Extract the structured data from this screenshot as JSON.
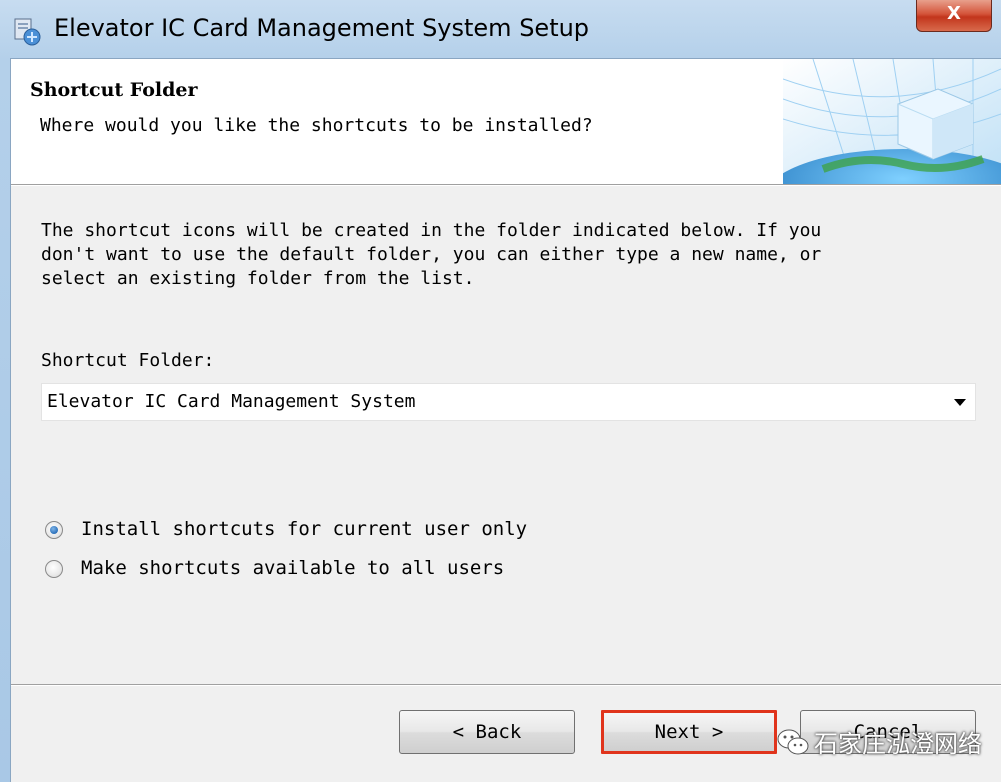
{
  "window": {
    "title": "Elevator IC Card Management System Setup",
    "close_label": "X"
  },
  "header": {
    "title": "Shortcut Folder",
    "subtitle": "Where would you like the shortcuts to be installed?"
  },
  "body": {
    "description": "The shortcut icons will be created in the folder indicated below. If you\ndon't want to use the default folder, you can either type a new name, or\nselect an existing folder from the list.",
    "folder_label": "Shortcut Folder:",
    "folder_value": "Elevator IC Card Management System"
  },
  "options": [
    {
      "label": "Install shortcuts for current user only",
      "selected": true
    },
    {
      "label": "Make shortcuts available to all users",
      "selected": false
    }
  ],
  "buttons": {
    "back": "< Back",
    "next": "Next >",
    "cancel": "Cancel"
  },
  "watermark": {
    "text": "石家庄泓澄网络"
  },
  "colors": {
    "highlight": "#e0341c",
    "titlebar": "#b4d0ea",
    "dialog_bg": "#f0f0f0"
  },
  "icons": [
    "installer-icon",
    "close-icon",
    "dropdown-arrow-icon",
    "header-globe-cube-image",
    "wechat-icon"
  ]
}
